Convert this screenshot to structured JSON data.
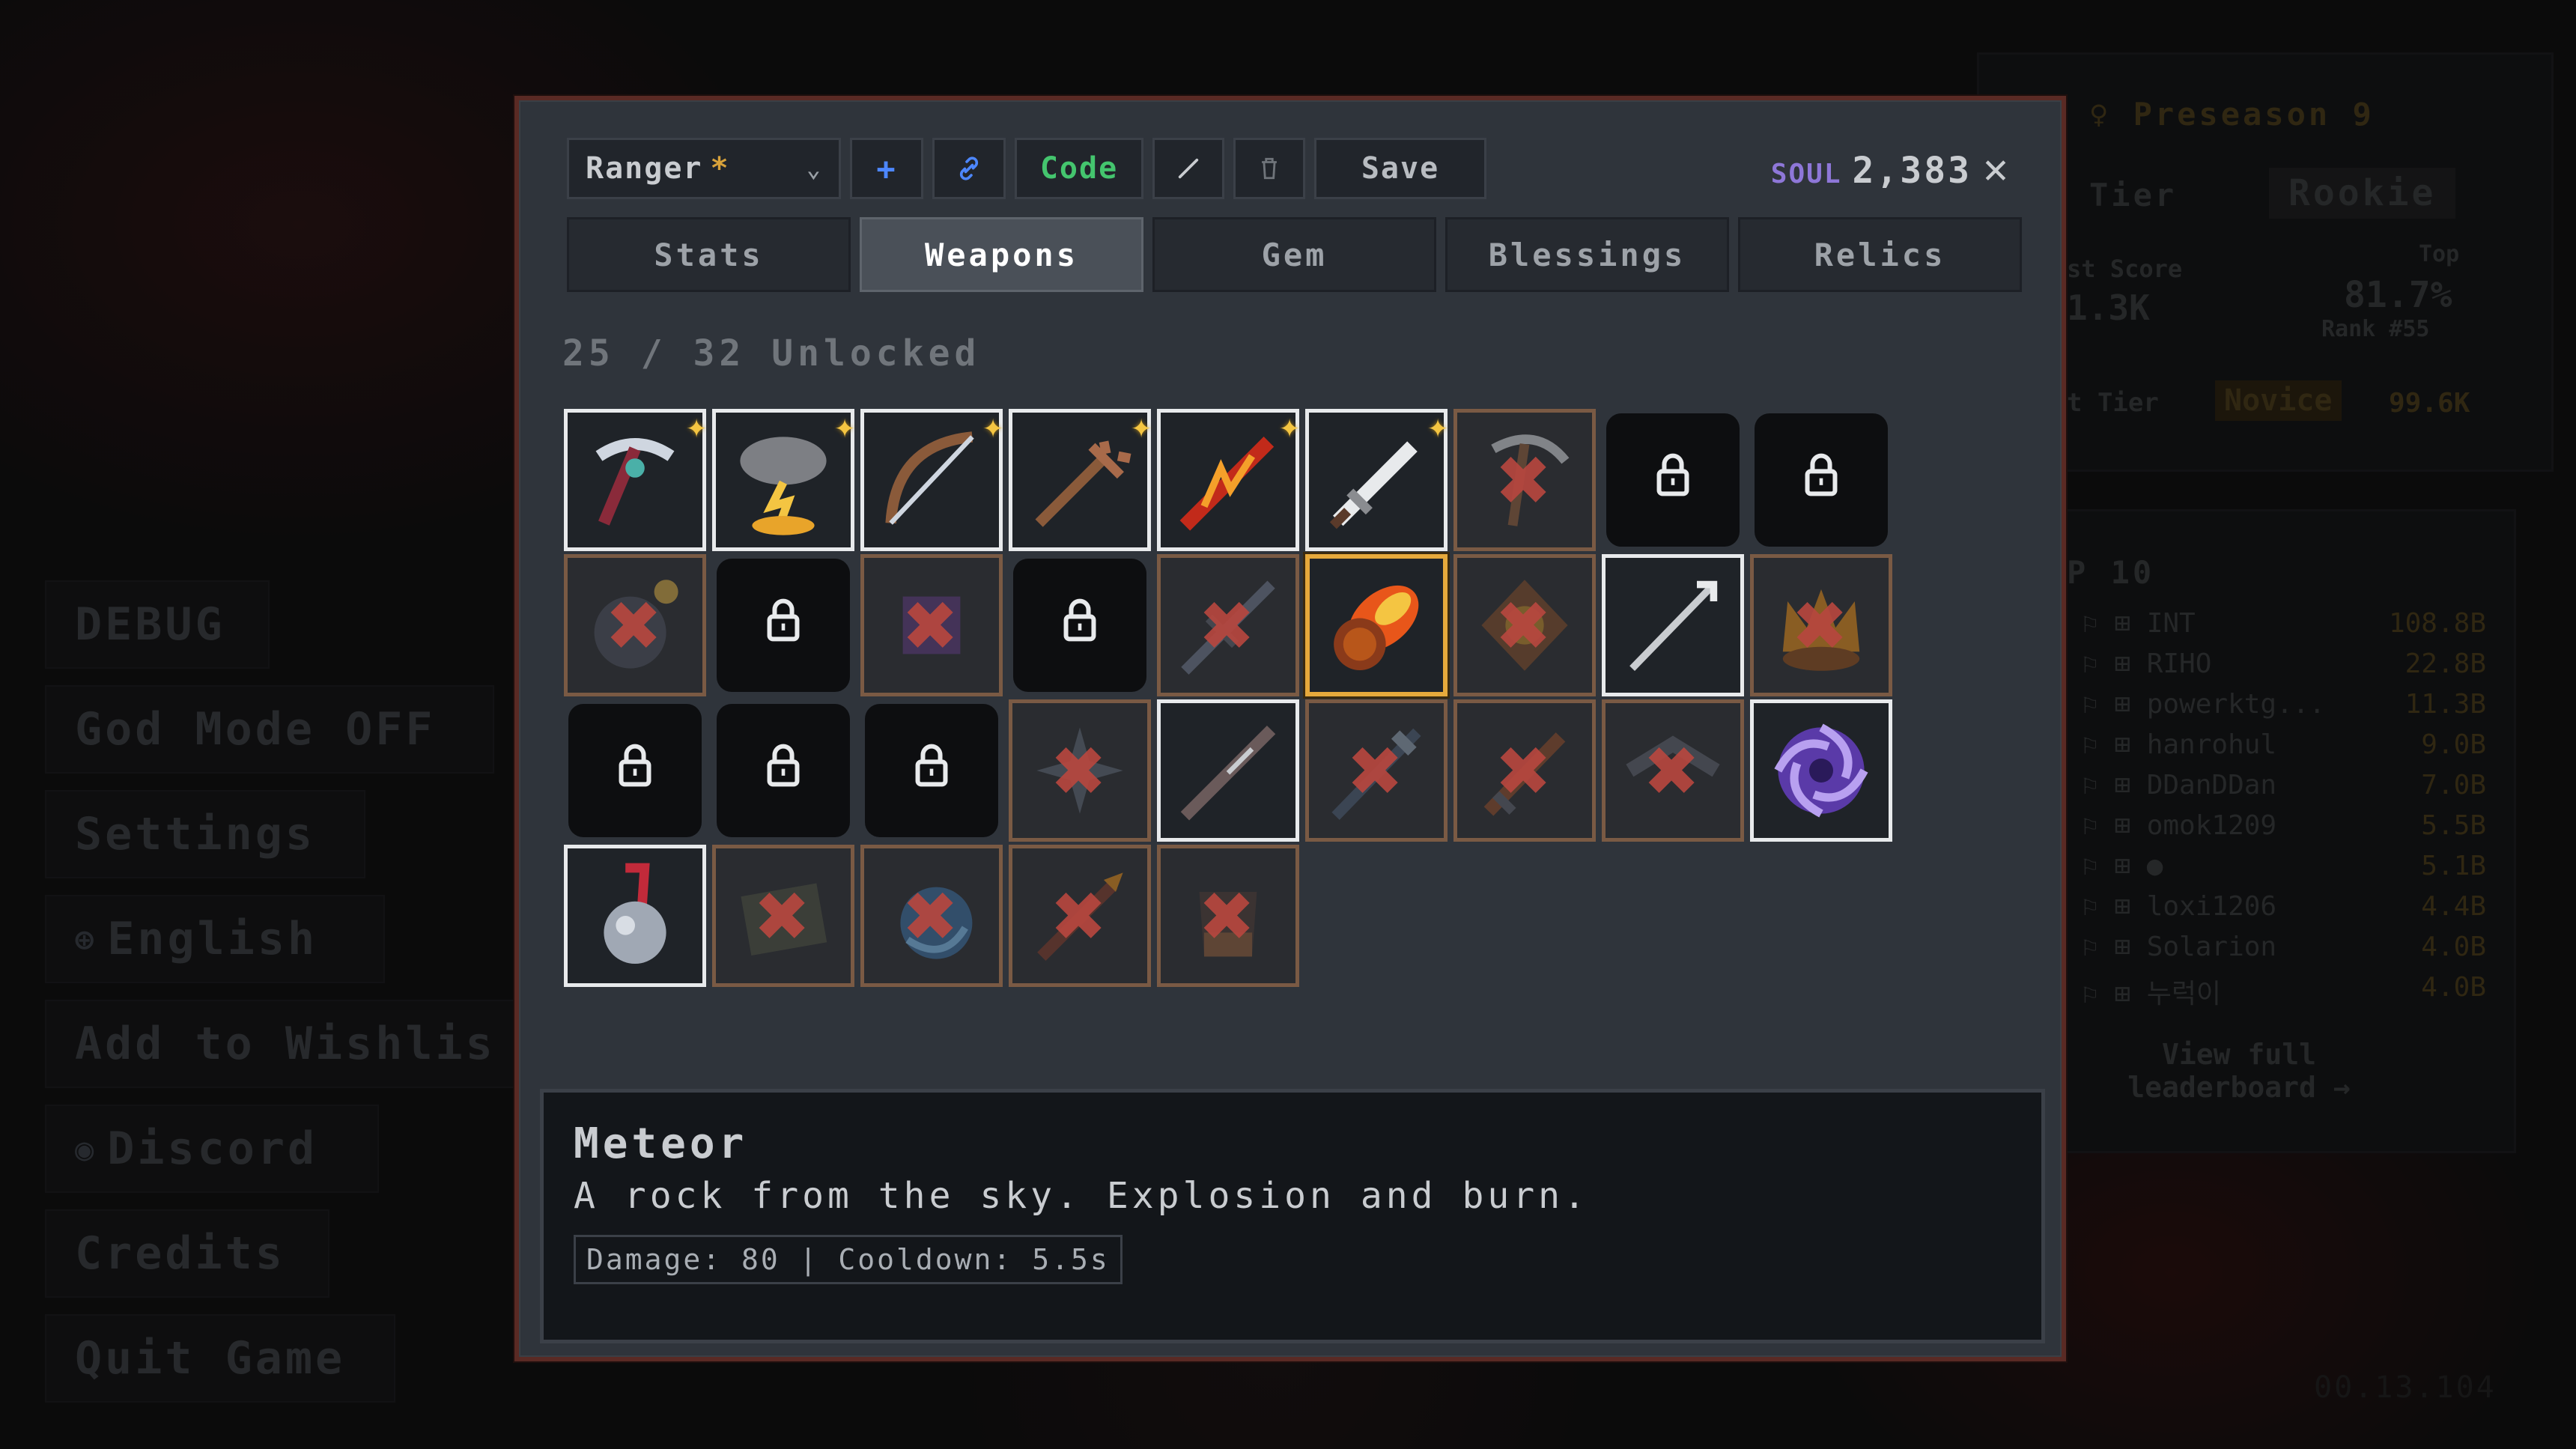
{
  "background_menu": {
    "items": [
      {
        "label": "DEBUG",
        "icon": ""
      },
      {
        "label": "God Mode OFF",
        "icon": ""
      },
      {
        "label": "Settings",
        "icon": ""
      },
      {
        "label": "English",
        "icon": "globe-icon"
      },
      {
        "label": "Add to Wishlis",
        "icon": ""
      },
      {
        "label": "Discord",
        "icon": "discord-icon"
      },
      {
        "label": "Credits",
        "icon": ""
      },
      {
        "label": "Quit Game",
        "icon": ""
      }
    ]
  },
  "season_panel": {
    "title": "Preseason 9",
    "tier_label": "Tier",
    "tier_value": "Rookie",
    "score_label": "st Score",
    "score_value": "1.3K",
    "top_label": "Top",
    "top_value": "81.7%",
    "rank": "Rank #55",
    "next_tier_label": "t Tier",
    "next_tier_value": "Novice",
    "next_tier_score": "99.6K"
  },
  "leaderboard": {
    "title": "P 10",
    "rows": [
      {
        "name": "INT",
        "score": "108.8B"
      },
      {
        "name": "RIHO",
        "score": "22.8B"
      },
      {
        "name": "powerktg...",
        "score": "11.3B"
      },
      {
        "name": "hanrohul",
        "score": "9.0B"
      },
      {
        "name": "DDanDDan",
        "score": "7.0B"
      },
      {
        "name": "omok1209",
        "score": "5.5B"
      },
      {
        "name": "●",
        "score": "5.1B"
      },
      {
        "name": "loxi1206",
        "score": "4.4B"
      },
      {
        "name": "Solarion",
        "score": "4.0B"
      },
      {
        "name": "누럭이",
        "score": "4.0B"
      }
    ],
    "view_full": "View full leaderboard →"
  },
  "version": "00.13.104",
  "modal": {
    "preset_name": "Ranger",
    "preset_star": "*",
    "buttons": {
      "add": "+",
      "link": "🔗",
      "code": "Code",
      "edit": "╱",
      "delete": "🗑",
      "save": "Save"
    },
    "soul_label": "SOUL",
    "soul_value": "2,383",
    "close": "✕",
    "tabs": [
      "Stats",
      "Weapons",
      "Gem",
      "Blessings",
      "Relics"
    ],
    "active_tab": "Weapons",
    "unlocked_text": "25 / 32 Unlocked",
    "weapons": [
      {
        "state": "owned",
        "icon": "pickaxe-icon",
        "starred": true
      },
      {
        "state": "owned",
        "icon": "storm-cloud-icon",
        "starred": true
      },
      {
        "state": "owned",
        "icon": "bow-icon",
        "starred": true
      },
      {
        "state": "owned",
        "icon": "trident-icon",
        "starred": true
      },
      {
        "state": "owned",
        "icon": "flame-spear-icon",
        "starred": true
      },
      {
        "state": "owned",
        "icon": "sword-icon",
        "starred": true
      },
      {
        "state": "available",
        "icon": "scythe-icon",
        "starred": false
      },
      {
        "state": "locked",
        "icon": "lock-icon",
        "starred": false
      },
      {
        "state": "locked",
        "icon": "lock-icon",
        "starred": false
      },
      {
        "state": "available",
        "icon": "bomb-icon",
        "starred": false
      },
      {
        "state": "locked",
        "icon": "lock-icon",
        "starred": false
      },
      {
        "state": "available",
        "icon": "purple-orb-icon",
        "starred": false
      },
      {
        "state": "locked",
        "icon": "lock-icon",
        "starred": false
      },
      {
        "state": "available",
        "icon": "lance-icon",
        "starred": false
      },
      {
        "state": "selected",
        "icon": "meteor-icon",
        "starred": false
      },
      {
        "state": "available",
        "icon": "star-shield-icon",
        "starred": false
      },
      {
        "state": "owned",
        "icon": "arrow-icon",
        "starred": false
      },
      {
        "state": "available",
        "icon": "fire-crown-icon",
        "starred": false
      },
      {
        "state": "locked",
        "icon": "lock-icon",
        "starred": false
      },
      {
        "state": "locked",
        "icon": "lock-icon",
        "starred": false
      },
      {
        "state": "locked",
        "icon": "lock-icon",
        "starred": false
      },
      {
        "state": "available",
        "icon": "shuriken-icon",
        "starred": false
      },
      {
        "state": "owned",
        "icon": "staff-icon",
        "starred": false
      },
      {
        "state": "available",
        "icon": "halberd-icon",
        "starred": false
      },
      {
        "state": "available",
        "icon": "dagger-icon",
        "starred": false
      },
      {
        "state": "available",
        "icon": "boomerang-icon",
        "starred": false
      },
      {
        "state": "owned",
        "icon": "vortex-icon",
        "starred": false
      },
      {
        "state": "owned",
        "icon": "potion-icon",
        "starred": false
      },
      {
        "state": "available",
        "icon": "book-icon",
        "starred": false
      },
      {
        "state": "available",
        "icon": "whirl-orb-icon",
        "starred": false
      },
      {
        "state": "available",
        "icon": "rocket-icon",
        "starred": false
      },
      {
        "state": "available",
        "icon": "gauntlet-icon",
        "starred": false
      }
    ],
    "selected": {
      "name": "Meteor",
      "description": "A rock from the sky. Explosion and burn.",
      "stats": "Damage: 80 | Cooldown: 5.5s"
    }
  },
  "colors": {
    "accent_gold": "#e6a93c",
    "soul_purple": "#8e77d8",
    "code_green": "#44c56e",
    "button_blue": "#4d87ff",
    "x_red": "#b7473f",
    "modal_border": "#5a2a24"
  }
}
